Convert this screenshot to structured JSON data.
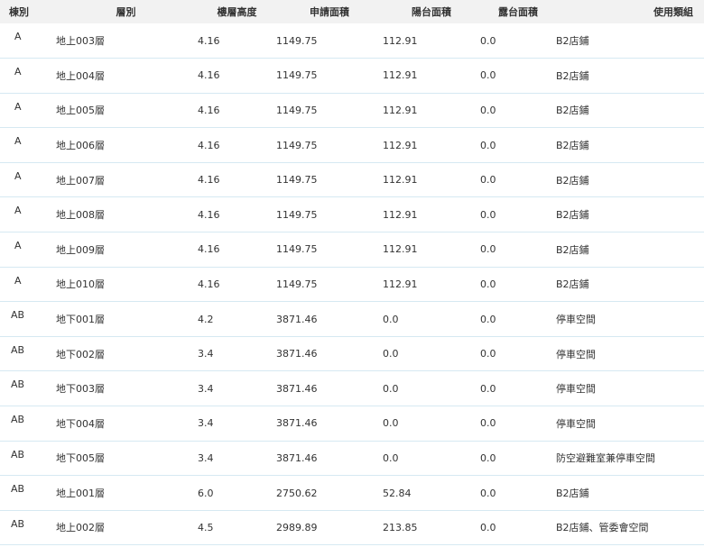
{
  "headers": [
    "棟別",
    "層別",
    "樓層高度",
    "申請面積",
    "陽台面積",
    "露台面積",
    "使用類組"
  ],
  "rows": [
    {
      "building": "A",
      "floor": "地上003層",
      "height": "4.16",
      "area": "1149.75",
      "balcony": "112.91",
      "terrace": "0.0",
      "use": "B2店鋪"
    },
    {
      "building": "A",
      "floor": "地上004層",
      "height": "4.16",
      "area": "1149.75",
      "balcony": "112.91",
      "terrace": "0.0",
      "use": "B2店鋪"
    },
    {
      "building": "A",
      "floor": "地上005層",
      "height": "4.16",
      "area": "1149.75",
      "balcony": "112.91",
      "terrace": "0.0",
      "use": "B2店鋪"
    },
    {
      "building": "A",
      "floor": "地上006層",
      "height": "4.16",
      "area": "1149.75",
      "balcony": "112.91",
      "terrace": "0.0",
      "use": "B2店鋪"
    },
    {
      "building": "A",
      "floor": "地上007層",
      "height": "4.16",
      "area": "1149.75",
      "balcony": "112.91",
      "terrace": "0.0",
      "use": "B2店鋪"
    },
    {
      "building": "A",
      "floor": "地上008層",
      "height": "4.16",
      "area": "1149.75",
      "balcony": "112.91",
      "terrace": "0.0",
      "use": "B2店鋪"
    },
    {
      "building": "A",
      "floor": "地上009層",
      "height": "4.16",
      "area": "1149.75",
      "balcony": "112.91",
      "terrace": "0.0",
      "use": "B2店鋪"
    },
    {
      "building": "A",
      "floor": "地上010層",
      "height": "4.16",
      "area": "1149.75",
      "balcony": "112.91",
      "terrace": "0.0",
      "use": "B2店鋪"
    },
    {
      "building": "AB",
      "floor": "地下001層",
      "height": "4.2",
      "area": "3871.46",
      "balcony": "0.0",
      "terrace": "0.0",
      "use": "停車空間"
    },
    {
      "building": "AB",
      "floor": "地下002層",
      "height": "3.4",
      "area": "3871.46",
      "balcony": "0.0",
      "terrace": "0.0",
      "use": "停車空間"
    },
    {
      "building": "AB",
      "floor": "地下003層",
      "height": "3.4",
      "area": "3871.46",
      "balcony": "0.0",
      "terrace": "0.0",
      "use": "停車空間"
    },
    {
      "building": "AB",
      "floor": "地下004層",
      "height": "3.4",
      "area": "3871.46",
      "balcony": "0.0",
      "terrace": "0.0",
      "use": "停車空間"
    },
    {
      "building": "AB",
      "floor": "地下005層",
      "height": "3.4",
      "area": "3871.46",
      "balcony": "0.0",
      "terrace": "0.0",
      "use": "防空避難室兼停車空間"
    },
    {
      "building": "AB",
      "floor": "地上001層",
      "height": "6.0",
      "area": "2750.62",
      "balcony": "52.84",
      "terrace": "0.0",
      "use": "B2店鋪"
    },
    {
      "building": "AB",
      "floor": "地上002層",
      "height": "4.5",
      "area": "2989.89",
      "balcony": "213.85",
      "terrace": "0.0",
      "use": "B2店鋪、管委會空間"
    }
  ]
}
